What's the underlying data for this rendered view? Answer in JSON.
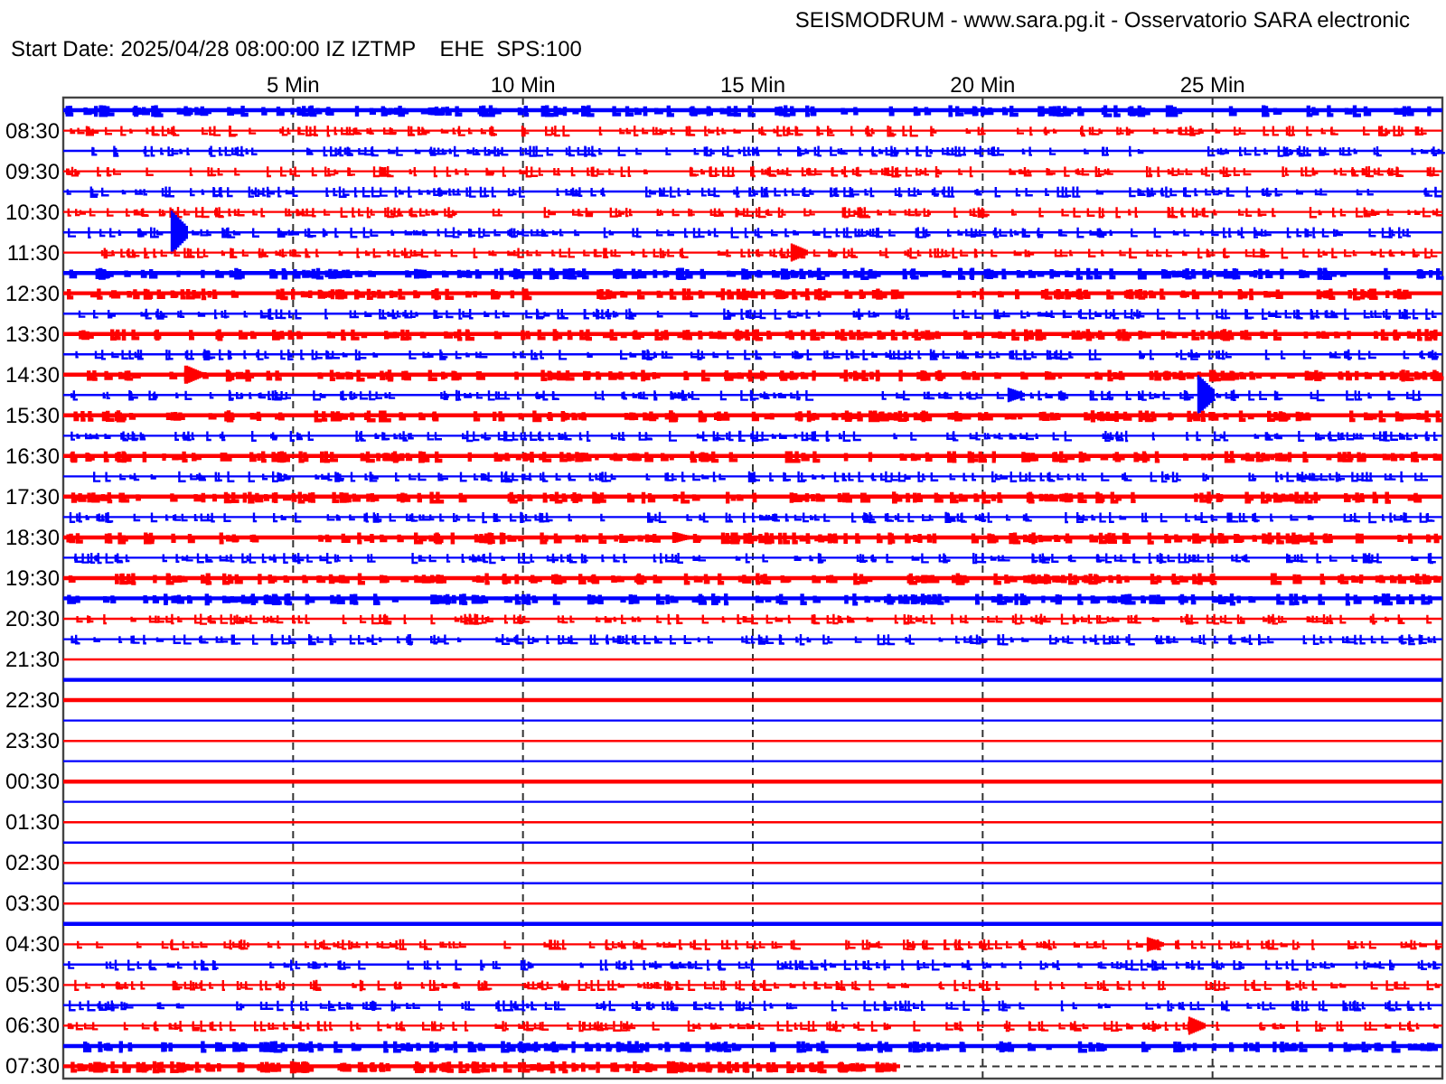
{
  "header": {
    "title": "SEISMODRUM - www.sara.pg.it - Osservatorio SARA electronic",
    "start_info": "Start Date: 2025/04/28 08:00:00 IZ IZTMP    EHE  SPS:100"
  },
  "chart": {
    "x_labels": [
      "5 Min",
      "10 Min",
      "15 Min",
      "20 Min",
      "25 Min"
    ],
    "row_labels": [
      "08:30",
      "09:30",
      "10:30",
      "11:30",
      "12:30",
      "13:30",
      "14:30",
      "15:30",
      "16:30",
      "17:30",
      "18:30",
      "19:30",
      "20:30",
      "21:30",
      "22:30",
      "23:30",
      "00:30",
      "01:30",
      "02:30",
      "03:30",
      "04:30",
      "05:30",
      "06:30",
      "07:30"
    ]
  }
}
